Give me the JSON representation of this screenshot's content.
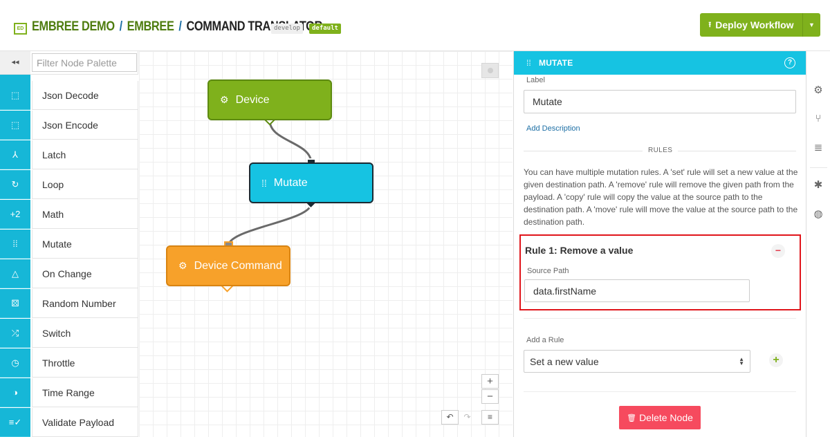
{
  "header": {
    "logo_text": "ED",
    "breadcrumbs": [
      "EMBREE DEMO",
      "EMBREE",
      "COMMAND TRANSLATOR"
    ],
    "separator": "/",
    "branch_tag": "develop",
    "version_tag": "default",
    "deploy_label": "Deploy Workflow",
    "deploy_icon": "⭱"
  },
  "palette": {
    "collapse_glyph": "◂◂",
    "filter_placeholder": "Filter Node Palette",
    "items": [
      {
        "icon": "json-decode-icon",
        "glyph": "⬚",
        "label": "Json Decode"
      },
      {
        "icon": "json-encode-icon",
        "glyph": "⬚",
        "label": "Json Encode"
      },
      {
        "icon": "latch-icon",
        "glyph": "⅄",
        "label": "Latch"
      },
      {
        "icon": "loop-icon",
        "glyph": "↻",
        "label": "Loop"
      },
      {
        "icon": "math-icon",
        "glyph": "+2",
        "label": "Math"
      },
      {
        "icon": "mutate-icon",
        "glyph": "⁞⁞",
        "label": "Mutate"
      },
      {
        "icon": "on-change-icon",
        "glyph": "△",
        "label": "On Change"
      },
      {
        "icon": "random-number-icon",
        "glyph": "⚄",
        "label": "Random Number"
      },
      {
        "icon": "switch-icon",
        "glyph": "⤮",
        "label": "Switch"
      },
      {
        "icon": "throttle-icon",
        "glyph": "◷",
        "label": "Throttle"
      },
      {
        "icon": "time-range-icon",
        "glyph": "◑",
        "label": "Time Range"
      },
      {
        "icon": "validate-payload-icon",
        "glyph": "≡✓",
        "label": "Validate Payload"
      }
    ]
  },
  "canvas": {
    "nodes": {
      "device": "Device",
      "mutate": "Mutate",
      "device_command": "Device Command"
    },
    "zoom_in": "+",
    "zoom_out": "−",
    "undo": "↶",
    "redo": "↷",
    "menu": "≡"
  },
  "panel": {
    "title": "MUTATE",
    "help": "?",
    "label_caption": "Label",
    "label_value": "Mutate",
    "add_description": "Add Description",
    "rules_heading": "RULES",
    "description": "You can have multiple mutation rules. A 'set' rule will set a new value at the given destination path. A 'remove' rule will remove the given path from the payload. A 'copy' rule will copy the value at the source path to the destination path. A 'move' rule will move the value at the source path to the destination path.",
    "rule": {
      "title": "Rule 1: Remove a value",
      "source_path_label": "Source Path",
      "source_path_value": "data.firstName",
      "remove_glyph": "−"
    },
    "add_rule_label": "Add a Rule",
    "add_rule_selected": "Set a new value",
    "add_glyph": "+",
    "delete_label": "Delete Node"
  },
  "strip": {
    "icons": [
      "gear-icon",
      "branch-icon",
      "database-icon",
      "bug-icon",
      "globe-icon"
    ]
  },
  "colors": {
    "brand_green": "#7fb11c",
    "accent_cyan": "#16c3e2",
    "palette_cyan": "#16b7d7",
    "node_orange": "#f7a12a",
    "danger": "#f64a5e",
    "highlight_red": "#e0141a"
  }
}
